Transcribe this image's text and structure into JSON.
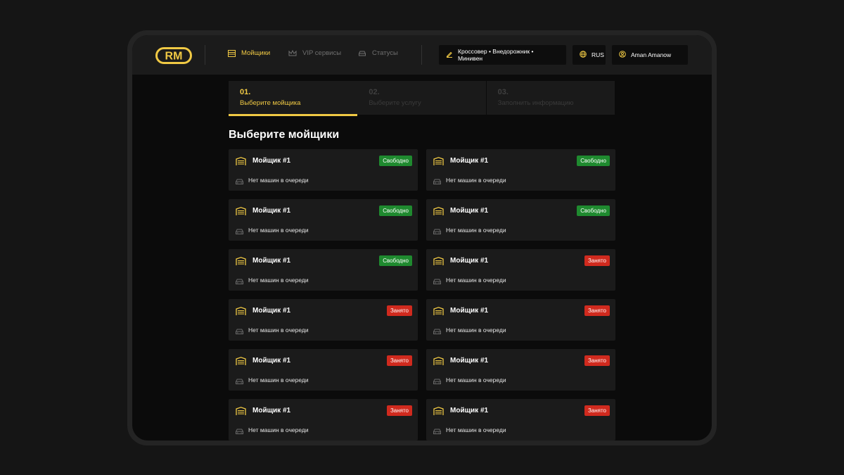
{
  "brand": {
    "logo_text": "RM",
    "accent": "#f0c944"
  },
  "nav": [
    {
      "label": "Мойщики",
      "icon": "washer-box-icon",
      "active": true
    },
    {
      "label": "VIP сервисы",
      "icon": "crown-icon",
      "active": false
    },
    {
      "label": "Статусы",
      "icon": "car-icon",
      "active": false
    }
  ],
  "header": {
    "car_types": "Кроссовер • Внедорожник • Минивен",
    "language": "RUS",
    "user_name": "Aman Amanow"
  },
  "steps": [
    {
      "num": "01.",
      "label": "Выберите мойщика",
      "active": true
    },
    {
      "num": "02.",
      "label": "Выберите услугу",
      "active": false
    },
    {
      "num": "03.",
      "label": "Заполнить информацию",
      "active": false
    }
  ],
  "page_title": "Выберите мойщики",
  "status_colors": {
    "free": "#1f8a2f",
    "busy": "#d02a1e"
  },
  "washers": [
    {
      "name": "Мойщик #1",
      "status": "Свободно",
      "state": "free",
      "queue": "Нет машин в очереди"
    },
    {
      "name": "Мойщик #1",
      "status": "Свободно",
      "state": "free",
      "queue": "Нет машин в очереди"
    },
    {
      "name": "Мойщик #1",
      "status": "Свободно",
      "state": "free",
      "queue": "Нет машин в очереди"
    },
    {
      "name": "Мойщик #1",
      "status": "Свободно",
      "state": "free",
      "queue": "Нет машин в очереди"
    },
    {
      "name": "Мойщик #1",
      "status": "Свободно",
      "state": "free",
      "queue": "Нет машин в очереди"
    },
    {
      "name": "Мойщик #1",
      "status": "Занято",
      "state": "busy",
      "queue": "Нет машин в очереди"
    },
    {
      "name": "Мойщик #1",
      "status": "Занято",
      "state": "busy",
      "queue": "Нет машин в очереди"
    },
    {
      "name": "Мойщик #1",
      "status": "Занято",
      "state": "busy",
      "queue": "Нет машин в очереди"
    },
    {
      "name": "Мойщик #1",
      "status": "Занято",
      "state": "busy",
      "queue": "Нет машин в очереди"
    },
    {
      "name": "Мойщик #1",
      "status": "Занято",
      "state": "busy",
      "queue": "Нет машин в очереди"
    },
    {
      "name": "Мойщик #1",
      "status": "Занято",
      "state": "busy",
      "queue": "Нет машин в очереди"
    },
    {
      "name": "Мойщик #1",
      "status": "Занято",
      "state": "busy",
      "queue": "Нет машин в очереди"
    }
  ]
}
